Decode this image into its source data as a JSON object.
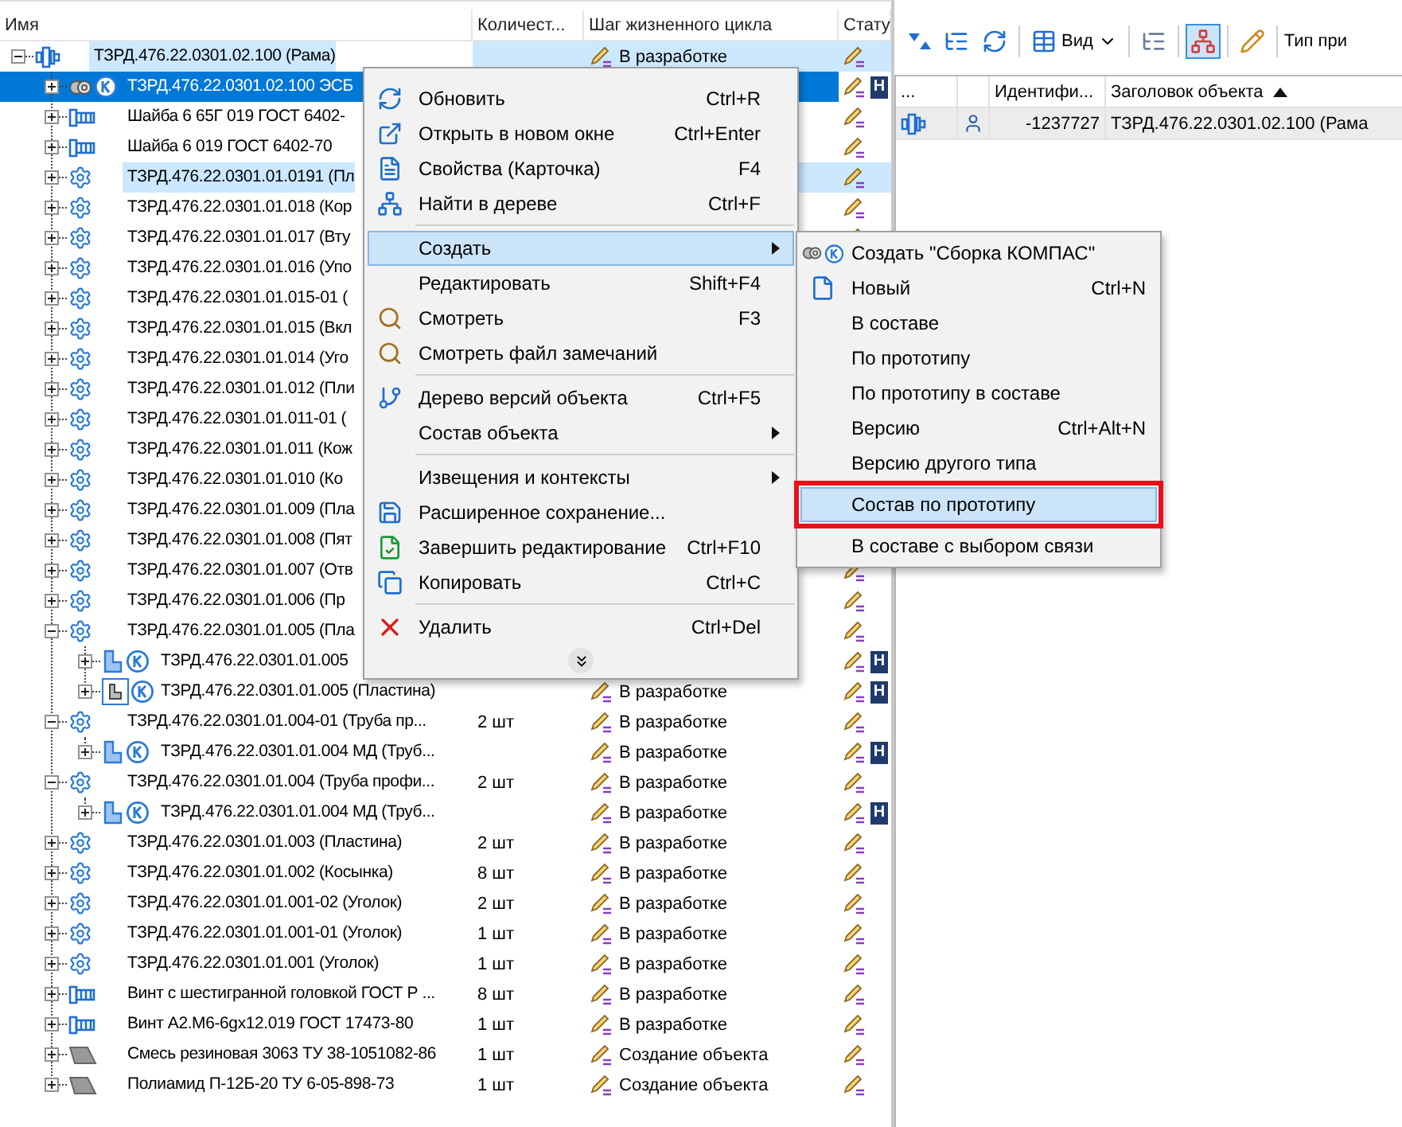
{
  "tree_header": {
    "columns": [
      {
        "label": "Имя"
      },
      {
        "label": "Количест..."
      },
      {
        "label": "Шаг жизненного цикла"
      },
      {
        "label": "Стату"
      }
    ]
  },
  "tree": {
    "name": "ТЗРД.476.22.0301.02.100 (Рама)",
    "kind": "assembly",
    "expanded": true,
    "selected": false,
    "highlighted": true,
    "step": "В разработке",
    "children": [
      {
        "name": "ТЗРД.476.22.0301.02.100 ЭСБ",
        "kind": "kompas-assembly",
        "expanded": false,
        "selected": true,
        "highlighted": false,
        "badge": "Н"
      },
      {
        "name": "Шайба 6 65Г 019 ГОСТ 6402-",
        "kind": "standard",
        "expanded": false,
        "selected": false,
        "highlighted": false
      },
      {
        "name": "Шайба 6 019 ГОСТ 6402-70",
        "kind": "standard",
        "expanded": false,
        "selected": false,
        "highlighted": false
      },
      {
        "name": "ТЗРД.476.22.0301.01.0191 (Пл",
        "kind": "part",
        "expanded": false,
        "selected": false,
        "highlighted": true
      },
      {
        "name": "ТЗРД.476.22.0301.01.018 (Кор",
        "kind": "part",
        "expanded": false,
        "selected": false,
        "highlighted": false
      },
      {
        "name": "ТЗРД.476.22.0301.01.017 (Вту",
        "kind": "part",
        "expanded": false,
        "selected": false,
        "highlighted": false
      },
      {
        "name": "ТЗРД.476.22.0301.01.016 (Упо",
        "kind": "part",
        "expanded": false,
        "selected": false,
        "highlighted": false
      },
      {
        "name": "ТЗРД.476.22.0301.01.015-01 (",
        "kind": "part",
        "expanded": false,
        "selected": false,
        "highlighted": false
      },
      {
        "name": "ТЗРД.476.22.0301.01.015 (Вкл",
        "kind": "part",
        "expanded": false,
        "selected": false,
        "highlighted": false
      },
      {
        "name": "ТЗРД.476.22.0301.01.014 (Уго",
        "kind": "part",
        "expanded": false,
        "selected": false,
        "highlighted": false
      },
      {
        "name": "ТЗРД.476.22.0301.01.012 (Пли",
        "kind": "part",
        "expanded": false,
        "selected": false,
        "highlighted": false
      },
      {
        "name": "ТЗРД.476.22.0301.01.011-01 (",
        "kind": "part",
        "expanded": false,
        "selected": false,
        "highlighted": false
      },
      {
        "name": "ТЗРД.476.22.0301.01.011 (Кож",
        "kind": "part",
        "expanded": false,
        "selected": false,
        "highlighted": false
      },
      {
        "name": "ТЗРД.476.22.0301.01.010 (Ко",
        "kind": "part",
        "expanded": false,
        "selected": false,
        "highlighted": false
      },
      {
        "name": "ТЗРД.476.22.0301.01.009 (Пла",
        "kind": "part",
        "expanded": false,
        "selected": false,
        "highlighted": false
      },
      {
        "name": "ТЗРД.476.22.0301.01.008 (Пят",
        "kind": "part",
        "expanded": false,
        "selected": false,
        "highlighted": false
      },
      {
        "name": "ТЗРД.476.22.0301.01.007 (Отв",
        "kind": "part",
        "expanded": false,
        "selected": false,
        "highlighted": false
      },
      {
        "name": "ТЗРД.476.22.0301.01.006 (Пр",
        "kind": "part",
        "expanded": false,
        "selected": false,
        "highlighted": false
      },
      {
        "name": "ТЗРД.476.22.0301.01.005 (Пла",
        "kind": "part",
        "expanded": true,
        "selected": false,
        "highlighted": false,
        "children": [
          {
            "name": "ТЗРД.476.22.0301.01.005",
            "kind": "kompas-part",
            "expanded": false,
            "selected": false,
            "highlighted": false,
            "badge": "Н"
          },
          {
            "name": "ТЗРД.476.22.0301.01.005 (Пластина)",
            "kind": "kompas-drawing",
            "expanded": false,
            "selected": false,
            "highlighted": false,
            "step": "В разработке",
            "badge": "Н"
          }
        ]
      },
      {
        "name": "ТЗРД.476.22.0301.01.004-01 (Труба пр...",
        "kind": "part",
        "expanded": true,
        "selected": false,
        "highlighted": false,
        "qty": "2 шт",
        "step": "В разработке",
        "children": [
          {
            "name": "ТЗРД.476.22.0301.01.004 МД (Труб...",
            "kind": "kompas-part",
            "expanded": false,
            "selected": false,
            "highlighted": false,
            "step": "В разработке",
            "badge": "Н"
          }
        ]
      },
      {
        "name": "ТЗРД.476.22.0301.01.004 (Труба профи...",
        "kind": "part",
        "expanded": true,
        "selected": false,
        "highlighted": false,
        "qty": "2 шт",
        "step": "В разработке",
        "children": [
          {
            "name": "ТЗРД.476.22.0301.01.004 МД (Труб...",
            "kind": "kompas-part",
            "expanded": false,
            "selected": false,
            "highlighted": false,
            "step": "В разработке",
            "badge": "Н"
          }
        ]
      },
      {
        "name": "ТЗРД.476.22.0301.01.003 (Пластина)",
        "kind": "part",
        "expanded": false,
        "selected": false,
        "highlighted": false,
        "qty": "2 шт",
        "step": "В разработке"
      },
      {
        "name": "ТЗРД.476.22.0301.01.002 (Косынка)",
        "kind": "part",
        "expanded": false,
        "selected": false,
        "highlighted": false,
        "qty": "8 шт",
        "step": "В разработке"
      },
      {
        "name": "ТЗРД.476.22.0301.01.001-02 (Уголок)",
        "kind": "part",
        "expanded": false,
        "selected": false,
        "highlighted": false,
        "qty": "2 шт",
        "step": "В разработке"
      },
      {
        "name": "ТЗРД.476.22.0301.01.001-01 (Уголок)",
        "kind": "part",
        "expanded": false,
        "selected": false,
        "highlighted": false,
        "qty": "1 шт",
        "step": "В разработке"
      },
      {
        "name": "ТЗРД.476.22.0301.01.001 (Уголок)",
        "kind": "part",
        "expanded": false,
        "selected": false,
        "highlighted": false,
        "qty": "1 шт",
        "step": "В разработке"
      },
      {
        "name": "Винт с шестигранной головкой ГОСТ Р ...",
        "kind": "standard",
        "expanded": false,
        "selected": false,
        "highlighted": false,
        "qty": "8 шт",
        "step": "В разработке"
      },
      {
        "name": "Винт А2.М6-6gx12.019 ГОСТ 17473-80",
        "kind": "standard",
        "expanded": false,
        "selected": false,
        "highlighted": false,
        "qty": "1 шт",
        "step": "В разработке"
      },
      {
        "name": "Смесь резиновая 3063  ТУ 38-1051082-86",
        "kind": "material",
        "expanded": false,
        "selected": false,
        "highlighted": false,
        "qty": "1 шт",
        "step": "Создание объекта"
      },
      {
        "name": "Полиамид П-12Б-20  ТУ 6-05-898-73",
        "kind": "material",
        "expanded": false,
        "selected": false,
        "highlighted": false,
        "qty": "1 шт",
        "step": "Создание объекта"
      }
    ]
  },
  "context_menu": {
    "groups": [
      [
        {
          "label": "Обновить",
          "shortcut": "Ctrl+R",
          "submenu": false,
          "selected": false
        },
        {
          "label": "Открыть в новом окне",
          "shortcut": "Ctrl+Enter",
          "submenu": false,
          "selected": false
        },
        {
          "label": "Свойства (Карточка)",
          "shortcut": "F4",
          "submenu": false,
          "selected": false
        },
        {
          "label": "Найти в дереве",
          "shortcut": "Ctrl+F",
          "submenu": false,
          "selected": false
        }
      ],
      [
        {
          "label": "Создать",
          "submenu": true,
          "selected": true
        },
        {
          "label": "Редактировать",
          "shortcut": "Shift+F4",
          "submenu": false,
          "selected": false
        },
        {
          "label": "Смотреть",
          "shortcut": "F3",
          "submenu": false,
          "selected": false
        },
        {
          "label": "Смотреть файл замечаний",
          "submenu": false,
          "selected": false
        }
      ],
      [
        {
          "label": "Дерево версий объекта",
          "shortcut": "Ctrl+F5",
          "submenu": false,
          "selected": false
        },
        {
          "label": "Состав объекта",
          "submenu": true,
          "selected": false
        }
      ],
      [
        {
          "label": "Извещения и контексты",
          "submenu": true,
          "selected": false
        },
        {
          "label": "Расширенное сохранение...",
          "submenu": false,
          "selected": false
        },
        {
          "label": "Завершить редактирование",
          "shortcut": "Ctrl+F10",
          "submenu": false,
          "selected": false
        },
        {
          "label": "Копировать",
          "shortcut": "Ctrl+C",
          "submenu": false,
          "selected": false
        }
      ],
      [
        {
          "label": "Удалить",
          "shortcut": "Ctrl+Del",
          "submenu": false,
          "selected": false
        }
      ]
    ]
  },
  "create_submenu": {
    "items": [
      {
        "label": "Создать \"Сборка КОМПАС\"",
        "selected": false,
        "framed": false
      },
      {
        "label": "Новый",
        "shortcut": "Ctrl+N",
        "selected": false,
        "framed": false
      },
      {
        "label": "В составе",
        "selected": false,
        "framed": false
      },
      {
        "label": "По прототипу",
        "selected": false,
        "framed": false
      },
      {
        "label": "По прототипу в составе",
        "selected": false,
        "framed": false
      },
      {
        "label": "Версию",
        "shortcut": "Ctrl+Alt+N",
        "selected": false,
        "framed": false
      },
      {
        "label": "Версию другого типа",
        "selected": false,
        "framed": false
      },
      {
        "label": "Состав по прототипу",
        "selected": true,
        "framed": true
      },
      {
        "label": "В составе с выбором связи",
        "selected": false,
        "framed": false
      }
    ]
  },
  "toolbar": {
    "view_button": "Вид",
    "structure_toggle_on": true,
    "type_label": "Тип при"
  },
  "grid": {
    "columns": [
      {
        "label": "..."
      },
      {
        "label": "Идентифи..."
      },
      {
        "label": "Заголовок объекта",
        "sorted_ascending": true
      }
    ],
    "rows": [
      {
        "id": "-1237727",
        "title": "ТЗРД.476.22.0301.02.100 (Рама",
        "selected": true
      }
    ]
  }
}
